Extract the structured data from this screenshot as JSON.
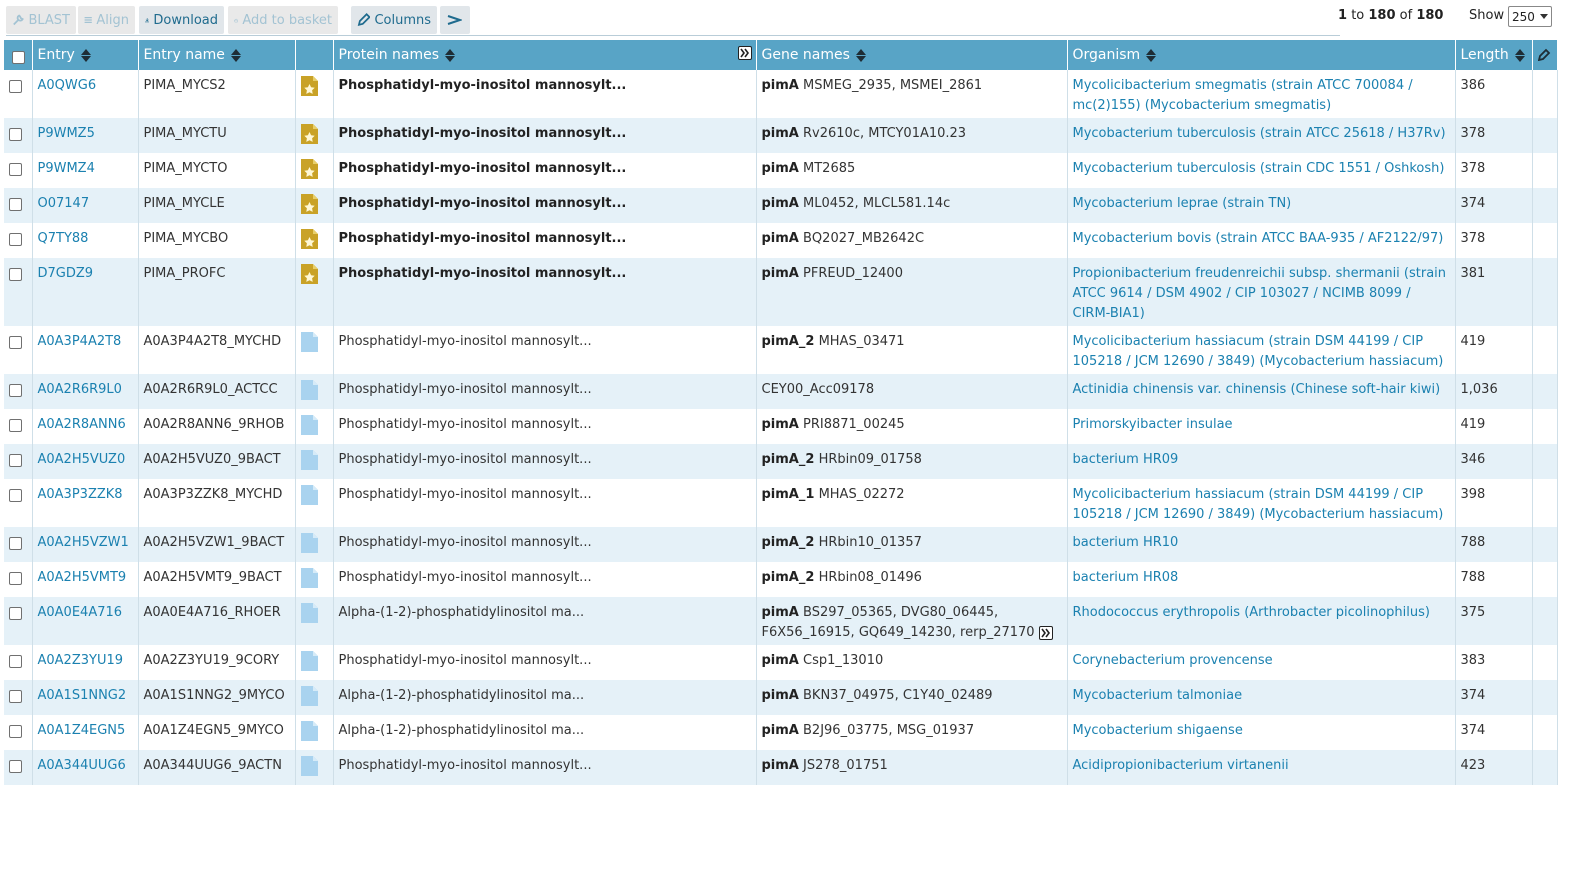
{
  "toolbar": {
    "blast_label": "BLAST",
    "align_label": "Align",
    "download_label": "Download",
    "basket_label": "Add to basket",
    "columns_label": "Columns",
    "results_from": "1",
    "results_to_word": "to",
    "results_to": "180",
    "results_of_word": "of",
    "results_total": "180",
    "show_label": "Show",
    "show_value": "250"
  },
  "colors": {
    "header_bg": "#58a4c6",
    "link": "#1b81b0",
    "row_alt": "#e5f1f8",
    "reviewed_icon": "#c9a227",
    "unreviewed_icon": "#a9d3ef"
  },
  "table": {
    "headers": {
      "entry": "Entry",
      "entry_name": "Entry name",
      "protein_names": "Protein names",
      "gene_names": "Gene names",
      "organism": "Organism",
      "length": "Length"
    },
    "rows": [
      {
        "entry": "A0QWG6",
        "entry_name": "PIMA_MYCS2",
        "status": "reviewed-icon",
        "protein": "Phosphatidyl-myo-inositol mannosylt...",
        "gene_primary": "pimA",
        "gene_other": "MSMEG_2935, MSMEI_2861",
        "organism": "Mycolicibacterium smegmatis (strain ATCC 700084 / mc(2)155) (Mycobacterium smegmatis)",
        "length": "386"
      },
      {
        "entry": "P9WMZ5",
        "entry_name": "PIMA_MYCTU",
        "status": "reviewed-icon",
        "protein": "Phosphatidyl-myo-inositol mannosylt...",
        "gene_primary": "pimA",
        "gene_other": "Rv2610c, MTCY01A10.23",
        "organism": "Mycobacterium tuberculosis (strain ATCC 25618 / H37Rv)",
        "length": "378"
      },
      {
        "entry": "P9WMZ4",
        "entry_name": "PIMA_MYCTO",
        "status": "reviewed-icon",
        "protein": "Phosphatidyl-myo-inositol mannosylt...",
        "gene_primary": "pimA",
        "gene_other": "MT2685",
        "organism": "Mycobacterium tuberculosis (strain CDC 1551 / Oshkosh)",
        "length": "378"
      },
      {
        "entry": "O07147",
        "entry_name": "PIMA_MYCLE",
        "status": "reviewed-icon",
        "protein": "Phosphatidyl-myo-inositol mannosylt...",
        "gene_primary": "pimA",
        "gene_other": "ML0452, MLCL581.14c",
        "organism": "Mycobacterium leprae (strain TN)",
        "length": "374"
      },
      {
        "entry": "Q7TY88",
        "entry_name": "PIMA_MYCBO",
        "status": "reviewed-icon",
        "protein": "Phosphatidyl-myo-inositol mannosylt...",
        "gene_primary": "pimA",
        "gene_other": "BQ2027_MB2642C",
        "organism": "Mycobacterium bovis (strain ATCC BAA-935 / AF2122/97)",
        "length": "378"
      },
      {
        "entry": "D7GDZ9",
        "entry_name": "PIMA_PROFC",
        "status": "reviewed-icon",
        "protein": "Phosphatidyl-myo-inositol mannosylt...",
        "gene_primary": "pimA",
        "gene_other": "PFREUD_12400",
        "organism": "Propionibacterium freudenreichii subsp. shermanii (strain ATCC 9614 / DSM 4902 / CIP 103027 / NCIMB 8099 / CIRM-BIA1)",
        "length": "381"
      },
      {
        "entry": "A0A3P4A2T8",
        "entry_name": "A0A3P4A2T8_MYCHD",
        "status": "unreviewed-icon",
        "protein": "Phosphatidyl-myo-inositol mannosylt...",
        "gene_primary": "pimA_2",
        "gene_other": "MHAS_03471",
        "organism": "Mycolicibacterium hassiacum (strain DSM 44199 / CIP 105218 / JCM 12690 / 3849) (Mycobacterium hassiacum)",
        "length": "419"
      },
      {
        "entry": "A0A2R6R9L0",
        "entry_name": "A0A2R6R9L0_ACTCC",
        "status": "unreviewed-icon",
        "protein": "Phosphatidyl-myo-inositol mannosylt...",
        "gene_primary": "",
        "gene_other": "CEY00_Acc09178",
        "organism": "Actinidia chinensis var. chinensis (Chinese soft-hair kiwi)",
        "length": "1,036"
      },
      {
        "entry": "A0A2R8ANN6",
        "entry_name": "A0A2R8ANN6_9RHOB",
        "status": "unreviewed-icon",
        "protein": "Phosphatidyl-myo-inositol mannosylt...",
        "gene_primary": "pimA",
        "gene_other": "PRI8871_00245",
        "organism": "Primorskyibacter insulae",
        "length": "419"
      },
      {
        "entry": "A0A2H5VUZ0",
        "entry_name": "A0A2H5VUZ0_9BACT",
        "status": "unreviewed-icon",
        "protein": "Phosphatidyl-myo-inositol mannosylt...",
        "gene_primary": "pimA_2",
        "gene_other": "HRbin09_01758",
        "organism": "bacterium HR09",
        "length": "346"
      },
      {
        "entry": "A0A3P3ZZK8",
        "entry_name": "A0A3P3ZZK8_MYCHD",
        "status": "unreviewed-icon",
        "protein": "Phosphatidyl-myo-inositol mannosylt...",
        "gene_primary": "pimA_1",
        "gene_other": "MHAS_02272",
        "organism": "Mycolicibacterium hassiacum (strain DSM 44199 / CIP 105218 / JCM 12690 / 3849) (Mycobacterium hassiacum)",
        "length": "398"
      },
      {
        "entry": "A0A2H5VZW1",
        "entry_name": "A0A2H5VZW1_9BACT",
        "status": "unreviewed-icon",
        "protein": "Phosphatidyl-myo-inositol mannosylt...",
        "gene_primary": "pimA_2",
        "gene_other": "HRbin10_01357",
        "organism": "bacterium HR10",
        "length": "788"
      },
      {
        "entry": "A0A2H5VMT9",
        "entry_name": "A0A2H5VMT9_9BACT",
        "status": "unreviewed-icon",
        "protein": "Phosphatidyl-myo-inositol mannosylt...",
        "gene_primary": "pimA_2",
        "gene_other": "HRbin08_01496",
        "organism": "bacterium HR08",
        "length": "788"
      },
      {
        "entry": "A0A0E4A716",
        "entry_name": "A0A0E4A716_RHOER",
        "status": "unreviewed-icon",
        "protein": "Alpha-(1-2)-phosphatidylinositol ma...",
        "gene_primary": "pimA",
        "gene_other": "BS297_05365, DVG80_06445, F6X56_16915, GQ649_14230, rerp_27170",
        "organism": "Rhodococcus erythropolis (Arthrobacter picolinophilus)",
        "length": "375",
        "gene_more": true
      },
      {
        "entry": "A0A2Z3YU19",
        "entry_name": "A0A2Z3YU19_9CORY",
        "status": "unreviewed-icon",
        "protein": "Phosphatidyl-myo-inositol mannosylt...",
        "gene_primary": "pimA",
        "gene_other": "Csp1_13010",
        "organism": "Corynebacterium provencense",
        "length": "383"
      },
      {
        "entry": "A0A1S1NNG2",
        "entry_name": "A0A1S1NNG2_9MYCO",
        "status": "unreviewed-icon",
        "protein": "Alpha-(1-2)-phosphatidylinositol ma...",
        "gene_primary": "pimA",
        "gene_other": "BKN37_04975, C1Y40_02489",
        "organism": "Mycobacterium talmoniae",
        "length": "374"
      },
      {
        "entry": "A0A1Z4EGN5",
        "entry_name": "A0A1Z4EGN5_9MYCO",
        "status": "unreviewed-icon",
        "protein": "Alpha-(1-2)-phosphatidylinositol ma...",
        "gene_primary": "pimA",
        "gene_other": "B2J96_03775, MSG_01937",
        "organism": "Mycobacterium shigaense",
        "length": "374"
      },
      {
        "entry": "A0A344UUG6",
        "entry_name": "A0A344UUG6_9ACTN",
        "status": "unreviewed-icon",
        "protein": "Phosphatidyl-myo-inositol mannosylt...",
        "gene_primary": "pimA",
        "gene_other": "JS278_01751",
        "organism": "Acidipropionibacterium virtanenii",
        "length": "423"
      }
    ]
  }
}
